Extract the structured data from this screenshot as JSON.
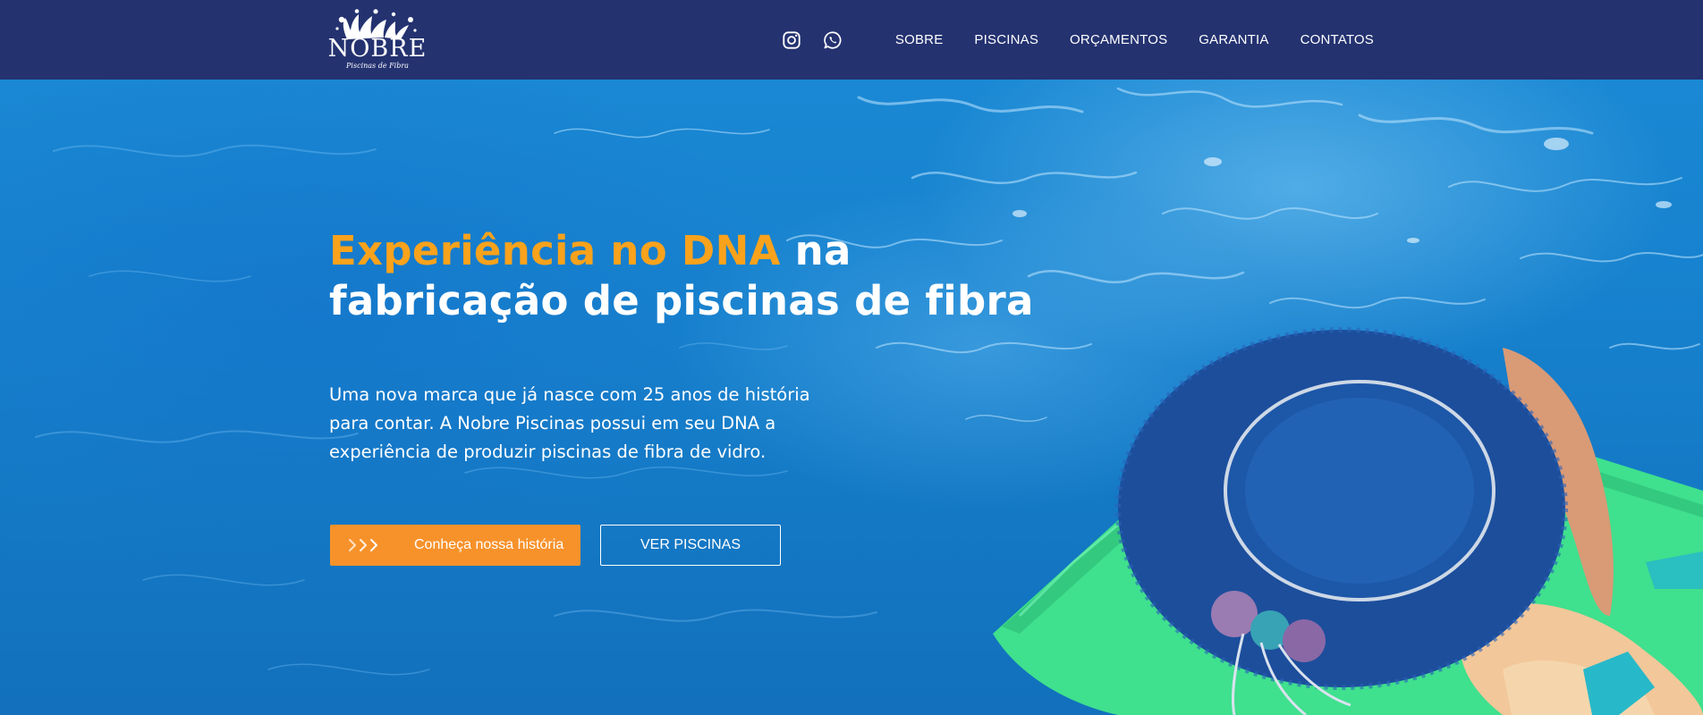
{
  "brand": {
    "name": "NOBRE",
    "tagline": "Piscinas de Fibra"
  },
  "nav": {
    "social": [
      {
        "icon": "instagram-icon"
      },
      {
        "icon": "whatsapp-icon"
      }
    ],
    "items": [
      {
        "label": "SOBRE"
      },
      {
        "label": "PISCINAS"
      },
      {
        "label": "ORÇAMENTOS"
      },
      {
        "label": "GARANTIA"
      },
      {
        "label": "CONTATOS"
      }
    ]
  },
  "hero": {
    "title_highlight": "Experiência no DNA",
    "title_rest": " na fabricação de piscinas de fibra",
    "text": "Uma nova marca que já nasce com 25 anos de história para contar. A Nobre Piscinas possui em seu DNA a experiência de produzir piscinas de fibra de vidro.",
    "primary_button": "Conheça nossa história",
    "secondary_button": "VER PISCINAS"
  },
  "colors": {
    "header_bg": "#243270",
    "accent": "#f9a21c",
    "button_primary": "#f7922b",
    "water": "#1680cd",
    "float": "#39d98a",
    "hat": "#1c4e9c"
  }
}
